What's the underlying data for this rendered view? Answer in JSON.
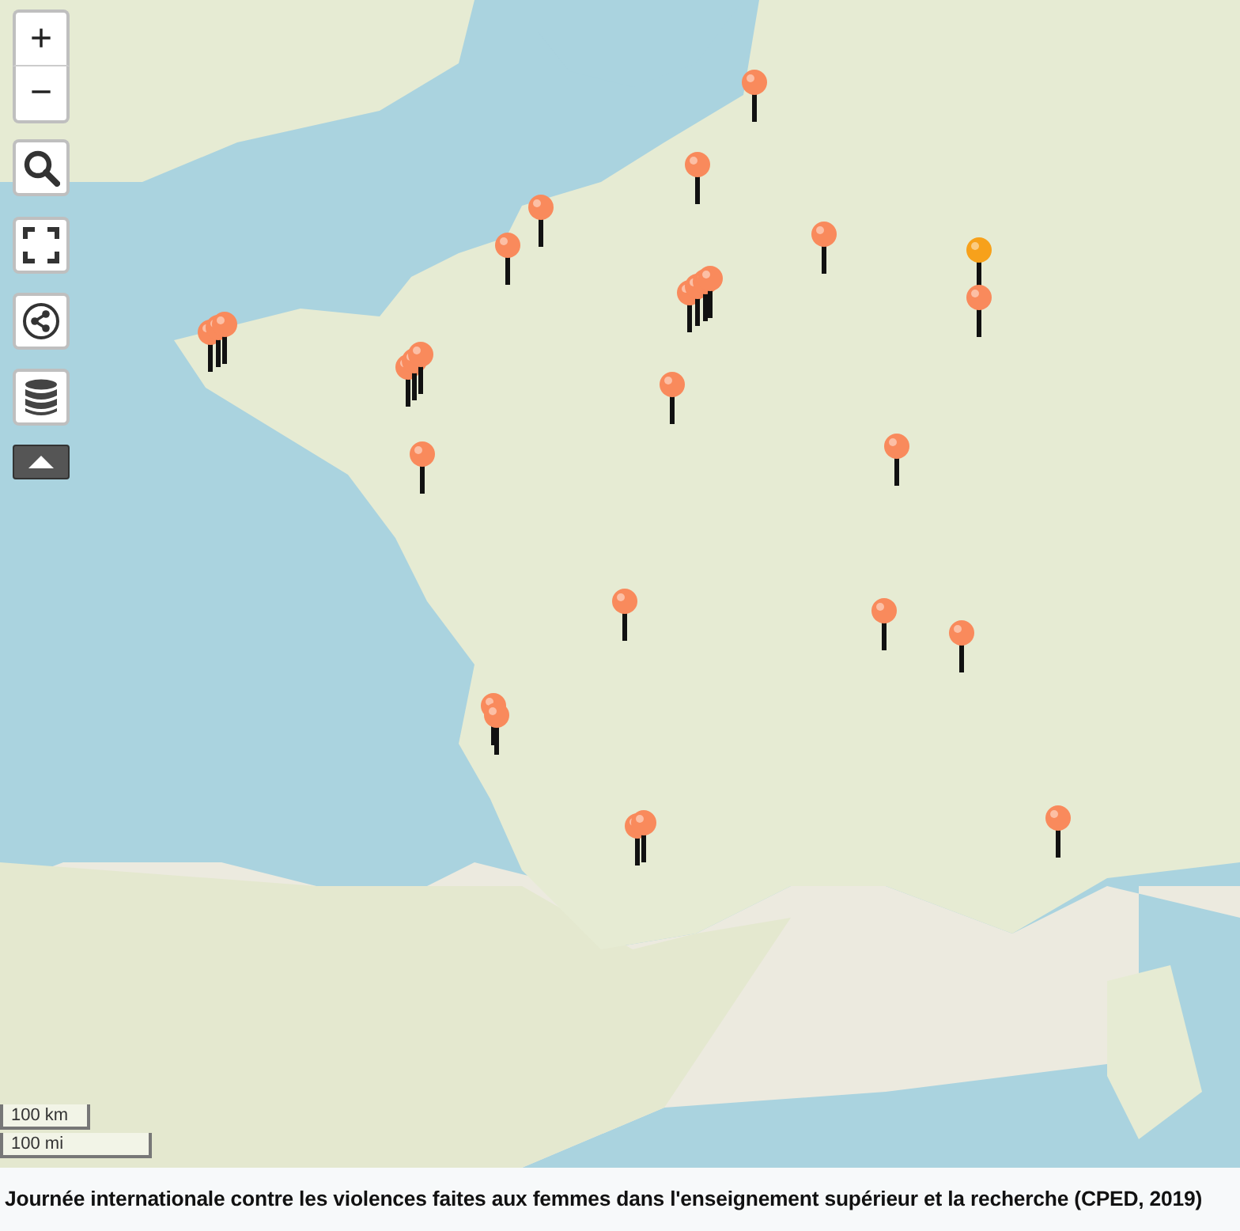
{
  "zoom": {
    "zoom_in": "+",
    "zoom_out": "−"
  },
  "tools": [
    {
      "kind": "search"
    },
    {
      "kind": "fullscreen"
    },
    {
      "kind": "share"
    },
    {
      "kind": "layers"
    },
    {
      "kind": "collapse"
    }
  ],
  "scale": {
    "metric": "100 km",
    "imperial": "100 mi"
  },
  "markers": [
    {
      "kind": "pin",
      "color": "#f98a5c"
    },
    {
      "kind": "pin",
      "color": "#f98a5c"
    },
    {
      "kind": "pin",
      "color": "#f98a5c"
    },
    {
      "kind": "pin",
      "color": "#f98a5c"
    },
    {
      "kind": "pin",
      "color": "#f98a5c"
    },
    {
      "kind": "pin",
      "color": "#f7a11b"
    },
    {
      "kind": "pin",
      "color": "#f98a5c"
    },
    {
      "kind": "cluster",
      "pins": [
        {
          "color": "#f98a5c"
        },
        {
          "color": "#f98a5c"
        },
        {
          "color": "#f98a5c"
        },
        {
          "color": "#f98a5c"
        }
      ]
    },
    {
      "kind": "cluster",
      "pins": [
        {
          "color": "#f98a5c"
        },
        {
          "color": "#f98a5c"
        },
        {
          "color": "#f98a5c"
        }
      ]
    },
    {
      "kind": "cluster",
      "pins": [
        {
          "color": "#f98a5c"
        },
        {
          "color": "#f98a5c"
        },
        {
          "color": "#f98a5c"
        }
      ]
    },
    {
      "kind": "pin",
      "color": "#f98a5c"
    },
    {
      "kind": "pin",
      "color": "#f98a5c"
    },
    {
      "kind": "pin",
      "color": "#f98a5c"
    },
    {
      "kind": "pin",
      "color": "#f98a5c"
    },
    {
      "kind": "pin",
      "color": "#f98a5c"
    },
    {
      "kind": "pin",
      "color": "#f98a5c"
    },
    {
      "kind": "cluster",
      "pins": [
        {
          "color": "#f98a5c"
        },
        {
          "color": "#f98a5c"
        }
      ]
    },
    {
      "kind": "cluster",
      "pins": [
        {
          "color": "#f98a5c"
        },
        {
          "color": "#f98a5c"
        }
      ]
    },
    {
      "kind": "pin",
      "color": "#f98a5c"
    }
  ],
  "caption": "Journée internationale contre les violences faites aux femmes dans l'enseignement supérieur et la recherche (CPED, 2019)"
}
